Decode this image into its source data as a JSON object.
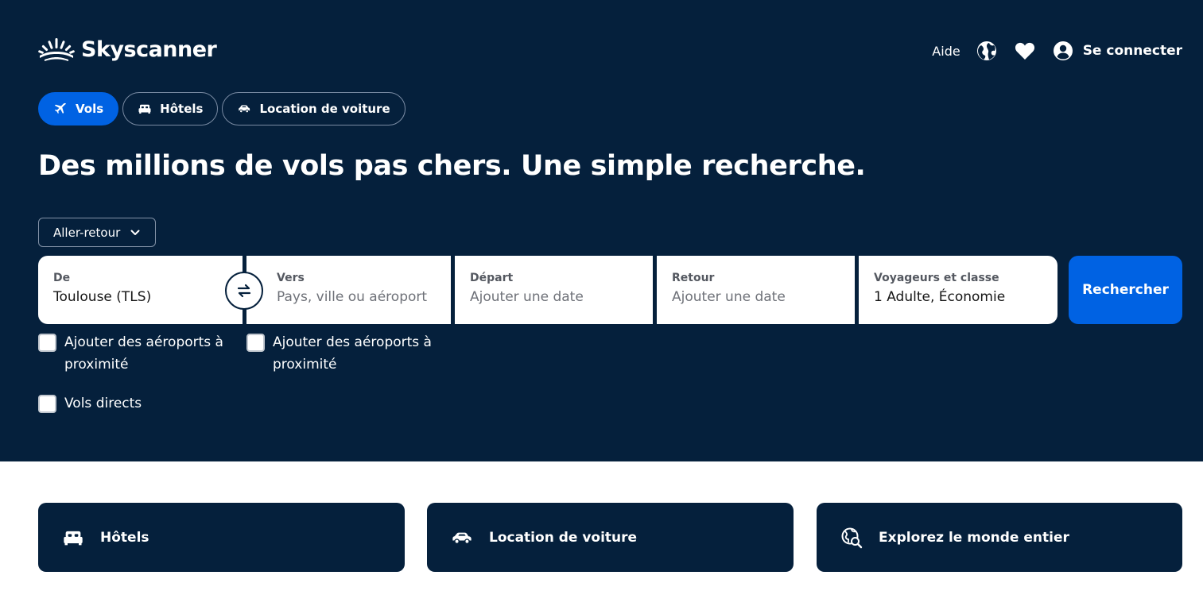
{
  "brand": {
    "name": "Skyscanner"
  },
  "header": {
    "help_label": "Aide",
    "login_label": "Se connecter"
  },
  "tabs": [
    {
      "label": "Vols",
      "icon": "plane-icon",
      "active": true
    },
    {
      "label": "Hôtels",
      "icon": "bed-icon",
      "active": false
    },
    {
      "label": "Location de voiture",
      "icon": "car-icon",
      "active": false
    }
  ],
  "headline": "Des millions de vols pas chers. Une simple recherche.",
  "trip_type": {
    "selected": "Aller-retour"
  },
  "search": {
    "from": {
      "label": "De",
      "value": "Toulouse (TLS)"
    },
    "to": {
      "label": "Vers",
      "placeholder": "Pays, ville ou aéroport"
    },
    "departure": {
      "label": "Départ",
      "placeholder": "Ajouter une date"
    },
    "return": {
      "label": "Retour",
      "placeholder": "Ajouter une date"
    },
    "travellers": {
      "label": "Voyageurs et classe",
      "value": "1 Adulte, Économie"
    },
    "submit_label": "Rechercher"
  },
  "options": {
    "nearby_from": "Ajouter des aéroports à proximité",
    "nearby_to": "Ajouter des aéroports à proximité",
    "direct": "Vols directs"
  },
  "cards": [
    {
      "label": "Hôtels",
      "icon": "bed-icon"
    },
    {
      "label": "Location de voiture",
      "icon": "car-icon"
    },
    {
      "label": "Explorez le monde entier",
      "icon": "explore-globe-icon"
    }
  ],
  "colors": {
    "navy": "#05203c",
    "accent_blue": "#0062e3",
    "white": "#ffffff"
  }
}
